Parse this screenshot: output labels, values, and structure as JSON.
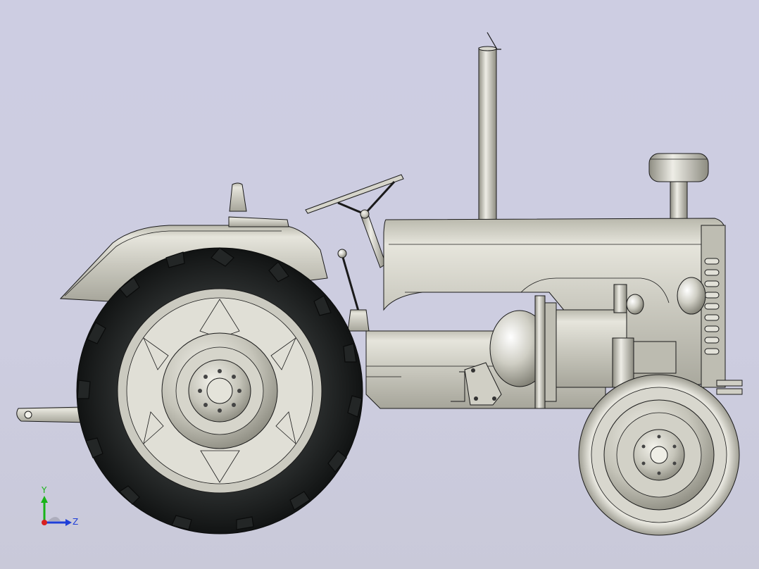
{
  "viewport": {
    "background_color": "#cdcde2",
    "model": {
      "name": "",
      "body_color": "#c8c7bd",
      "edge_color": "#1a1a1a",
      "tire_color": "#1b1d1d"
    },
    "triad": {
      "y_label": "Y",
      "z_label": "Z",
      "y_color": "#18b418",
      "z_color": "#1f3fd8",
      "x_color": "#d82020"
    }
  }
}
